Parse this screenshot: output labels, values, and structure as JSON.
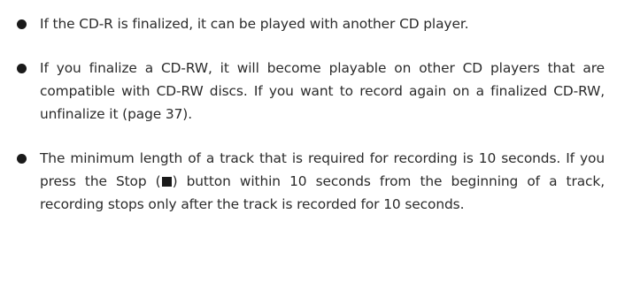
{
  "notes": [
    {
      "text": "If the CD-R is finalized, it can be played with another CD player."
    },
    {
      "text": "If you finalize a CD-RW, it will become playable on other CD players that are compatible with CD-RW discs. If you want to record again on a finalized CD-RW, unfinalize it (page 37)."
    },
    {
      "text_before": "The minimum length of a track that is required for recording is 10 seconds. If you press the Stop (",
      "stop_icon": "stop-square-icon",
      "text_after": ") button within 10 seconds from the beginning of a track, recording stops only after the track is recorded for 10 seconds."
    }
  ]
}
